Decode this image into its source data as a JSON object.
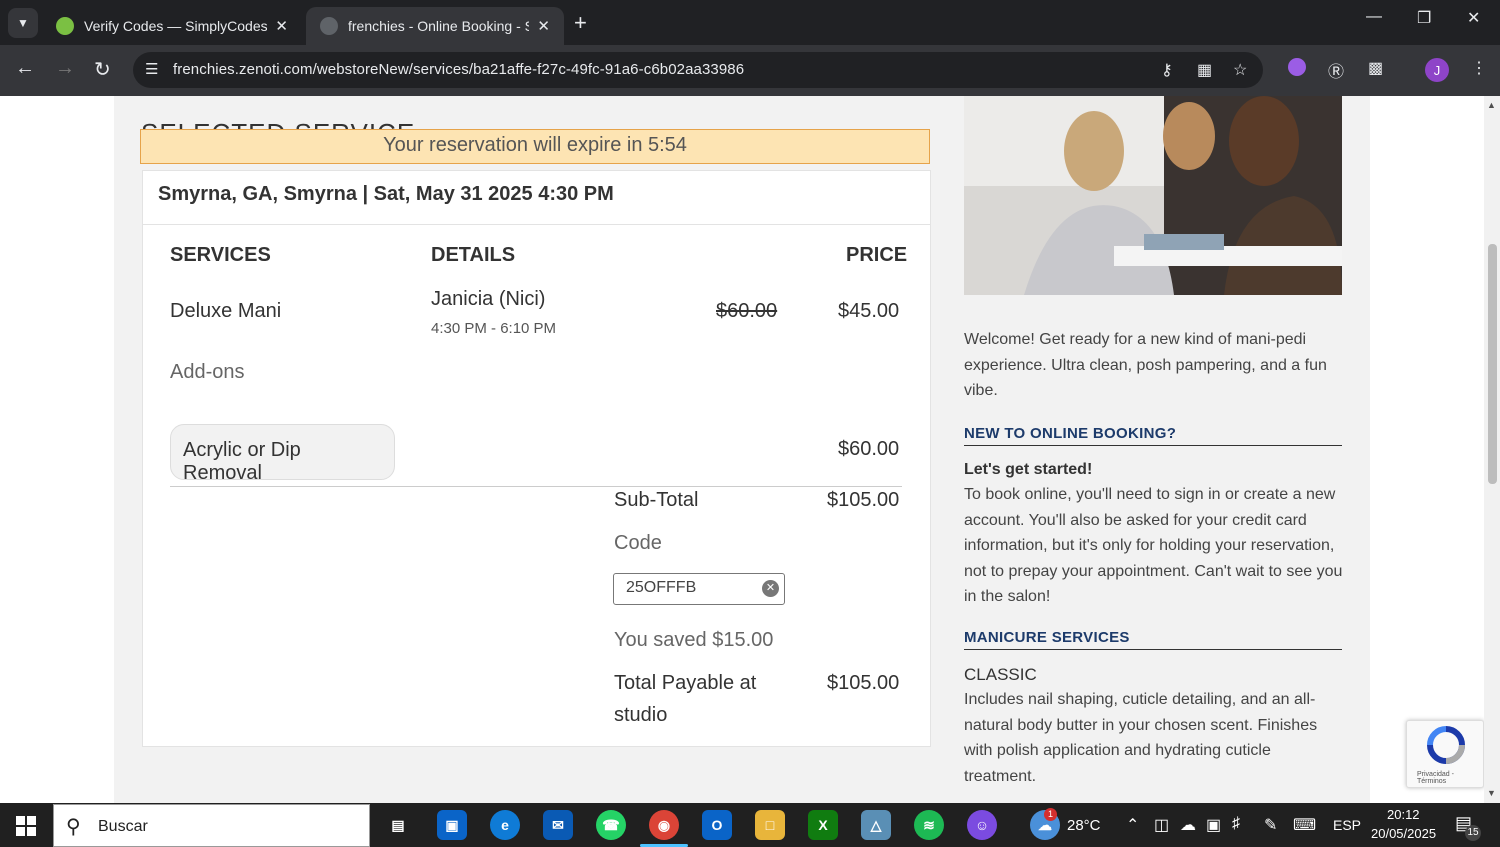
{
  "browser": {
    "tabs": [
      {
        "title": "Verify Codes — SimplyCodes",
        "favicon_color": "#7bc043"
      },
      {
        "title": "frenchies - Online Booking - Se",
        "favicon_color": "#9aa0a6"
      }
    ],
    "url": "frenchies.zenoti.com/webstoreNew/services/ba21affe-f27c-49fc-91a6-c6b02aa33986",
    "profile_initial": "J"
  },
  "page": {
    "section_title": "SELECTED SERVICE",
    "expire_text": "Your reservation will expire in 5:54",
    "booking_header": "Smyrna, GA, Smyrna | Sat, May 31 2025 4:30 PM",
    "columns": {
      "services": "SERVICES",
      "details": "DETAILS",
      "price": "PRICE"
    },
    "service": {
      "name": "Deluxe Mani",
      "staff": "Janicia (Nici)",
      "time": "4:30 PM - 6:10 PM",
      "old_price": "$60.00",
      "price": "$45.00"
    },
    "addons_label": "Add-ons",
    "addon": {
      "name": "Acrylic or Dip Removal",
      "price": "$60.00"
    },
    "subtotal_label": "Sub-Total",
    "subtotal_value": "$105.00",
    "code_label": "Code",
    "code_value": "25OFFFB",
    "saved_text": "You saved $15.00",
    "total_label_1": "Total Payable at",
    "total_label_2": "studio",
    "total_value": "$105.00"
  },
  "sidebar": {
    "welcome": "Welcome! Get ready for a new kind of mani-pedi experience. Ultra clean, posh pampering, and a fun vibe.",
    "new_booking_heading": "NEW TO ONLINE BOOKING?",
    "get_started": "Let's get started!",
    "booking_info": "To book online, you'll need to sign in or create a new account. You'll also be asked for your credit card information, but it's only for holding your reservation, not to prepay your appointment. Can't wait to see you in the salon!",
    "manicure_heading": "MANICURE SERVICES",
    "classic_title": "CLASSIC",
    "classic_desc": "Includes nail shaping, cuticle detailing, and an all-natural body butter in your chosen scent. Finishes with polish application and hydrating cuticle treatment.",
    "recaptcha_text": "Privacidad - Términos"
  },
  "taskbar": {
    "search_placeholder": "Buscar",
    "weather": "28°C",
    "weather_badge": "1",
    "language": "ESP",
    "time": "20:12",
    "date": "20/05/2025",
    "notifications": "15"
  }
}
